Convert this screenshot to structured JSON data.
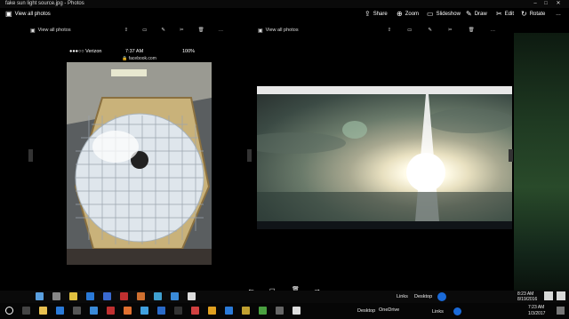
{
  "window": {
    "title": "fake sun light source.jpg - Photos",
    "minimize_glyph": "–",
    "maximize_glyph": "□",
    "close_glyph": "✕"
  },
  "outer": {
    "view_all_label": "View all photos",
    "actions": [
      {
        "label": "Share",
        "icon": "share-icon",
        "glyph": "⇪"
      },
      {
        "label": "Zoom",
        "icon": "zoom-icon",
        "glyph": "⊕"
      },
      {
        "label": "Slideshow",
        "icon": "slideshow-icon",
        "glyph": "▭"
      },
      {
        "label": "Draw",
        "icon": "draw-icon",
        "glyph": "✎"
      },
      {
        "label": "Edit",
        "icon": "edit-icon",
        "glyph": "✂"
      },
      {
        "label": "Rotate",
        "icon": "rotate-icon",
        "glyph": "↻"
      }
    ],
    "more_glyph": "…"
  },
  "left_window": {
    "view_all_label": "View all photos",
    "phone": {
      "carrier": "●●●○○ Verizon",
      "time": "7:37 AM",
      "battery": "100%",
      "url": "🔒 facebook.com"
    }
  },
  "right_window": {
    "view_all_label": "View all photos"
  },
  "photo_bar": {
    "prev_glyph": "←",
    "next_glyph": "→",
    "delete_glyph": "🗑",
    "comment_glyph": "▭"
  },
  "taskbar_inner": {
    "links_label": "Links",
    "desktop_label": "Desktop",
    "time": "8:23 AM",
    "date": "8/19/2016"
  },
  "taskbar_outer": {
    "desktop_label": "Desktop",
    "onedrive_label": "OneDrive",
    "links_label": "Links",
    "time": "7:23 AM",
    "date": "1/3/2017"
  }
}
